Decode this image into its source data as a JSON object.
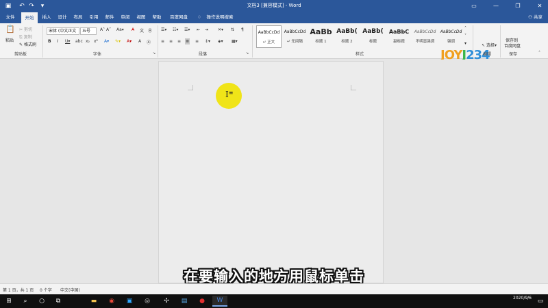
{
  "window": {
    "title": "文档3 [兼容模式] - Word",
    "quick_access": {
      "save_icon": "save-icon",
      "undo_icon": "undo-icon",
      "redo_icon": "redo-icon",
      "customize_icon": "chevron-down-icon"
    }
  },
  "tabs": [
    "文件",
    "开始",
    "插入",
    "设计",
    "布局",
    "引用",
    "邮件",
    "审阅",
    "视图",
    "帮助",
    "百度网盘"
  ],
  "active_tab": "开始",
  "tell_me": "操作说明搜索",
  "share": "共享",
  "ribbon": {
    "clipboard": {
      "paste": "粘贴",
      "cut": "剪切",
      "copy": "复制",
      "format_painter": "格式刷",
      "label": "剪贴板"
    },
    "font": {
      "font_name": "宋体 (中文正文",
      "font_size": "五号",
      "label": "字体"
    },
    "paragraph": {
      "label": "段落"
    },
    "styles": {
      "label": "样式",
      "items": [
        {
          "sample": "AaBbCcDd",
          "name": "正文"
        },
        {
          "sample": "AaBbCcDd",
          "name": "无间隔"
        },
        {
          "sample": "AaBb",
          "name": "标题 1"
        },
        {
          "sample": "AaBb(",
          "name": "标题 2"
        },
        {
          "sample": "AaBb(",
          "name": "标题"
        },
        {
          "sample": "AaBbC",
          "name": "副标题"
        },
        {
          "sample": "AaBbCcDd",
          "name": "不明显强调"
        },
        {
          "sample": "AaBbCcDd",
          "name": "强调"
        }
      ]
    },
    "editing": {
      "select": "选择",
      "label": "编辑"
    },
    "save": {
      "save_to": "保存到",
      "baidu": "百度网盘",
      "label": "保存"
    }
  },
  "watermark": {
    "part1": "JOY",
    "part2": "J",
    "part3": "234"
  },
  "subtitle": "在要输入的地方用鼠标单击",
  "status": {
    "page": "第 1 页，共 1 页",
    "words": "0 个字",
    "language": "中文(中国)"
  },
  "taskbar": {
    "icons": [
      "windows-icon",
      "search-icon",
      "task-view-icon",
      "file-explorer-icon",
      "chrome-icon",
      "photoshop-icon",
      "obs-icon",
      "usb-icon",
      "app-icon",
      "record-icon",
      "word-icon"
    ],
    "date": "2020/9/6"
  }
}
